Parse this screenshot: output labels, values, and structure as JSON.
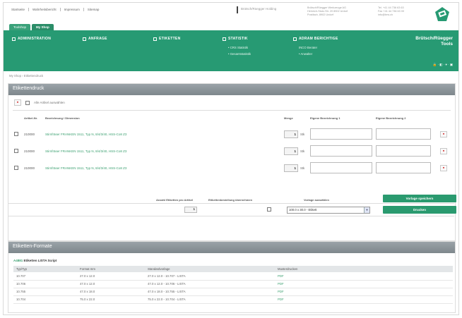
{
  "top": {
    "links": [
      "Startseite",
      "Wahrheitsbericht",
      "Impressum",
      "Sitemap"
    ],
    "company_name": "Brütsch/Rüegger Holding",
    "address_lines": [
      "Brütsch/Rüegger Werkzeuge AG",
      "Heinrich-Stutz-Str. 20 8902 Urdorf",
      "Postfach, 8902 Urdorf"
    ],
    "contact_lines": [
      "Tel. +41 44 736 63 63",
      "Fax +41 44 736 63 00",
      "info@brw.ch"
    ]
  },
  "shop_tabs": [
    "Toolshop",
    "My Shop"
  ],
  "nav": {
    "items": [
      {
        "label": "ADMINISTRATION"
      },
      {
        "label": "ANFRAGE"
      },
      {
        "label": "ETIKETTEN"
      },
      {
        "label": "STATISTIK",
        "subs": [
          "• CRS Statistik",
          "• Gesamtstatistik"
        ]
      },
      {
        "label": "ADRAM BERICHTIGE",
        "subs": [
          "INCO Berater",
          "• Anwalter"
        ]
      }
    ],
    "brand_line1": "Brütsch/Rüegger",
    "brand_line2": "Tools",
    "tools": "🔒 · ◧ · ▾ · ▣"
  },
  "breadcrumb": "My Shop  ›  Etikettendruck",
  "labels_section": {
    "title": "Etikettendruck",
    "select_all_label": "Alle Artikel auswählen",
    "columns": {
      "article": "Artikel-Nr.",
      "description": "Bezeichnung / Dimension",
      "quantity": "Menge",
      "own_label_1": "Eigene Bezeichnung 1",
      "own_label_2": "Eigene Bezeichnung 2"
    },
    "rows": [
      {
        "article": "210000",
        "description": "Stirnfräser FRANKEN 1511, Typ N, 8/4/3/40, HSS-Co8 Z3",
        "quantity": "1",
        "unit": "Stk"
      },
      {
        "article": "210000",
        "description": "Stirnfräser FRANKEN 1511, Typ N, 8/4/3/40, HSS-Co8 Z3",
        "quantity": "1",
        "unit": "Stk"
      },
      {
        "article": "210000",
        "description": "Stirnfräser FRANKEN 1511, Typ N, 8/4/3/40, HSS-Co8 Z3",
        "quantity": "1",
        "unit": "Stk"
      }
    ],
    "options": {
      "copies_label": "Anzahl Etiketten pro Artikel",
      "copies_value": "1",
      "print_label": "Etikettenbestellung übernehmen",
      "layout_label": "Vorlage auswählen",
      "layout_value": "100.0 x 30.0 - Etikett",
      "save_template_button": "Vorlage speichern",
      "print_button": "Drucken"
    }
  },
  "formats_section": {
    "title": "Etiketten-Formate",
    "subtitle_code": "A4881",
    "subtitle_text": "Etiketten LISTA Script",
    "columns": [
      "Typ/Typ",
      "Format mm",
      "Standardvorlage",
      "Musterdrucken"
    ],
    "rows": [
      {
        "type": "10.707",
        "format": "27.0 x 12.0",
        "template": "27.0 x 12.0 - 10.707 - LISTA",
        "sample": "PDF"
      },
      {
        "type": "10.706",
        "format": "47.0 x 12.0",
        "template": "47.0 x 12.0 - 10.706 - LISTA",
        "sample": "PDF"
      },
      {
        "type": "10.755",
        "format": "47.0 x 18.0",
        "template": "47.0 x 18.0 - 10.755 - LISTA",
        "sample": "PDF"
      },
      {
        "type": "10.704",
        "format": "75.0 x 22.0",
        "template": "75.0 x 22.0 - 10.704 - LISTA",
        "sample": "PDF"
      }
    ]
  },
  "colors": {
    "brand_green": "#279a73",
    "link_green": "#3ba070",
    "section_grey": "#8a9398",
    "remove_red": "#d12c2c"
  }
}
